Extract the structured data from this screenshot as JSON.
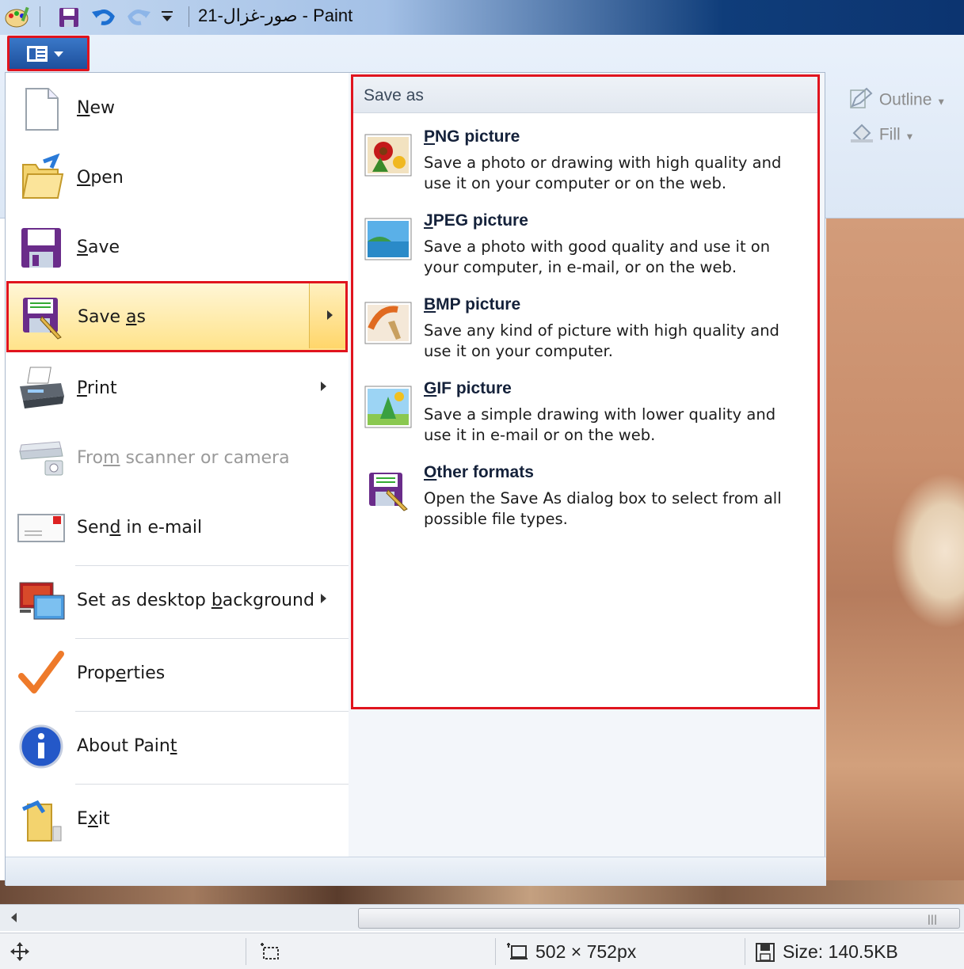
{
  "window": {
    "title": "صور-غزال-21 - Paint"
  },
  "ribbon": {
    "outline_label": "Outline",
    "fill_label": "Fill"
  },
  "menu": {
    "items": [
      {
        "label": "New",
        "mnemonic": "N"
      },
      {
        "label": "Open",
        "mnemonic": "O"
      },
      {
        "label": "Save",
        "mnemonic": "S"
      },
      {
        "label": "Save as",
        "mnemonic": "a"
      },
      {
        "label": "Print",
        "mnemonic": "P"
      },
      {
        "label": "From scanner or camera",
        "mnemonic": "m",
        "disabled": true
      },
      {
        "label": "Send in e-mail",
        "mnemonic": "d"
      },
      {
        "label": "Set as desktop background",
        "mnemonic": "b"
      },
      {
        "label": "Properties",
        "mnemonic": "e"
      },
      {
        "label": "About Paint",
        "mnemonic": "t"
      },
      {
        "label": "Exit",
        "mnemonic": "x"
      }
    ]
  },
  "save_as_panel": {
    "header": "Save as",
    "options": [
      {
        "title": "PNG picture",
        "desc": "Save a photo or drawing with high quality and use it on your computer or on the web."
      },
      {
        "title": "JPEG picture",
        "desc": "Save a photo with good quality and use it on your computer, in e-mail, or on the web."
      },
      {
        "title": "BMP picture",
        "desc": "Save any kind of picture with high quality and use it on your computer."
      },
      {
        "title": "GIF picture",
        "desc": "Save a simple drawing with lower quality and use it in e-mail or on the web."
      },
      {
        "title": "Other formats",
        "desc": "Open the Save As dialog box to select from all possible file types."
      }
    ]
  },
  "status": {
    "dimensions": "502 × 752px",
    "size": "Size: 140.5KB"
  },
  "colors": {
    "highlight_border": "#e0141e",
    "hover_fill": "#ffe38a",
    "title_bar_dark": "#0c3470"
  },
  "icons": [
    "paint-app-icon",
    "save-icon",
    "undo-icon",
    "redo-icon",
    "customize-icon",
    "app-menu-icon",
    "new-file-icon",
    "open-folder-icon",
    "floppy-save-icon",
    "save-as-icon",
    "printer-icon",
    "scanner-icon",
    "email-icon",
    "desktop-background-icon",
    "checkmark-icon",
    "info-icon",
    "exit-icon",
    "png-icon",
    "jpeg-icon",
    "bmp-icon",
    "gif-icon",
    "other-formats-icon",
    "pencil-outline-icon",
    "bucket-fill-icon",
    "move-cursor-icon",
    "selection-icon",
    "canvas-size-icon",
    "disk-size-icon"
  ]
}
